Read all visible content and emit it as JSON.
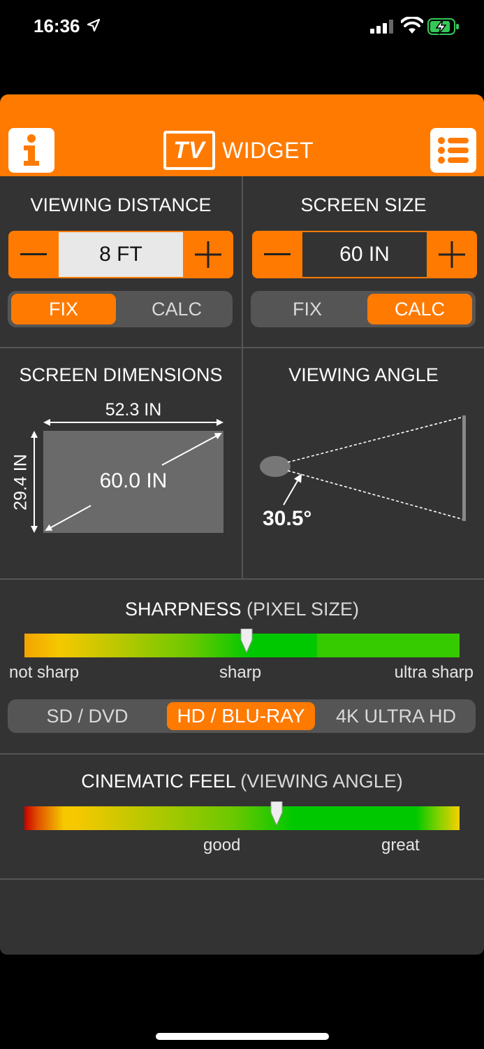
{
  "status_bar": {
    "time": "16:36",
    "location_icon": "location-arrow-icon",
    "signal_icon": "cellular-signal-icon",
    "wifi_icon": "wifi-icon",
    "battery_icon": "battery-charging-icon"
  },
  "header": {
    "brand_box": "TV",
    "brand_word": "WIDGET",
    "info_icon": "info-icon",
    "menu_icon": "list-menu-icon",
    "accent": "#ff7a00"
  },
  "viewing_distance": {
    "title": "VIEWING DISTANCE",
    "value": "8 FT",
    "mode_fix": "FIX",
    "mode_calc": "CALC",
    "active_mode": "FIX"
  },
  "screen_size": {
    "title": "SCREEN SIZE",
    "value": "60 IN",
    "mode_fix": "FIX",
    "mode_calc": "CALC",
    "active_mode": "CALC"
  },
  "screen_dimensions": {
    "title": "SCREEN DIMENSIONS",
    "width": "52.3 IN",
    "height": "29.4 IN",
    "diagonal": "60.0 IN"
  },
  "viewing_angle": {
    "title": "VIEWING ANGLE",
    "angle": "30.5°"
  },
  "sharpness": {
    "title_main": "SHARPNESS",
    "title_sub": "(PIXEL SIZE)",
    "level": 0.51,
    "labels": {
      "low": "not sharp",
      "mid": "sharp",
      "high": "ultra sharp"
    },
    "formats": [
      "SD / DVD",
      "HD / BLU-RAY",
      "4K ULTRA HD"
    ],
    "active_format": "HD / BLU-RAY"
  },
  "cinematic": {
    "title_main": "CINEMATIC FEEL",
    "title_sub": "(VIEWING ANGLE)",
    "level": 0.58,
    "labels": {
      "mid": "good",
      "high": "great"
    }
  }
}
